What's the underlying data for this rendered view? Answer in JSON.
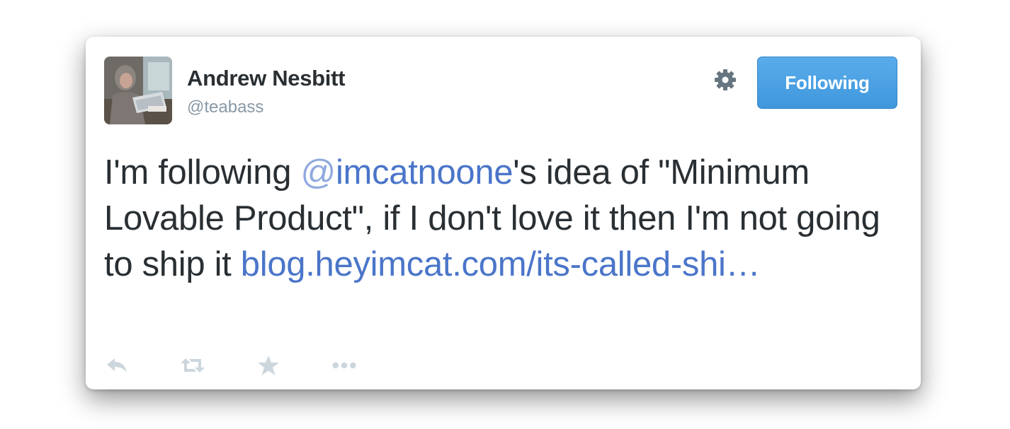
{
  "tweet": {
    "author": {
      "name": "Andrew Nesbitt",
      "handle": "@teabass"
    },
    "follow_button_label": "Following",
    "text_parts": {
      "before_mention": "I'm following ",
      "mention_at": "@",
      "mention_name": "imcatnoone",
      "after_mention": "'s idea of \"Minimum Lovable Product\", if I don't love it then I'm not going to ship it ",
      "link": "blog.heyimcat.com/its-called-shi…"
    },
    "actions": [
      "reply-icon",
      "retweet-icon",
      "favorite-icon",
      "more-icon"
    ]
  },
  "colors": {
    "text": "#292f33",
    "handle": "#8899a6",
    "link": "#4a75c9",
    "button": "#4ca3e6",
    "icon": "#ccd6dd"
  }
}
